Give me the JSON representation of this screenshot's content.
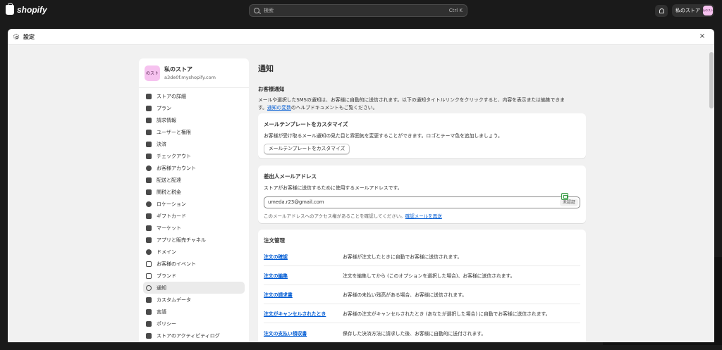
{
  "topbar": {
    "logo_text": "shopify",
    "search_placeholder": "検索",
    "search_shortcut": "Ctrl K",
    "store_name": "私のストア",
    "store_avatar_text": "私のスト"
  },
  "modal": {
    "title": "設定",
    "close_label": "×"
  },
  "sidebar": {
    "store_avatar_text": "のスト",
    "store_name": "私のストア",
    "store_domain": "a3de0f.myshopify.com",
    "items": [
      {
        "label": "ストアの詳細",
        "icon": "store-icon"
      },
      {
        "label": "プラン",
        "icon": "plan-icon"
      },
      {
        "label": "請求情報",
        "icon": "billing-icon"
      },
      {
        "label": "ユーザーと権限",
        "icon": "users-icon"
      },
      {
        "label": "決済",
        "icon": "payments-icon"
      },
      {
        "label": "チェックアウト",
        "icon": "cart-icon"
      },
      {
        "label": "お客様アカウント",
        "icon": "account-icon"
      },
      {
        "label": "配送と配達",
        "icon": "truck-icon"
      },
      {
        "label": "関税と税金",
        "icon": "tax-icon"
      },
      {
        "label": "ロケーション",
        "icon": "location-icon"
      },
      {
        "label": "ギフトカード",
        "icon": "gift-card-icon"
      },
      {
        "label": "マーケット",
        "icon": "market-icon"
      },
      {
        "label": "アプリと販売チャネル",
        "icon": "apps-icon"
      },
      {
        "label": "ドメイン",
        "icon": "globe-icon"
      },
      {
        "label": "お客様のイベント",
        "icon": "events-icon"
      },
      {
        "label": "ブランド",
        "icon": "brand-icon"
      },
      {
        "label": "通知",
        "icon": "bell-icon"
      },
      {
        "label": "カスタムデータ",
        "icon": "data-icon"
      },
      {
        "label": "言語",
        "icon": "language-icon"
      },
      {
        "label": "ポリシー",
        "icon": "policy-icon"
      },
      {
        "label": "ストアのアクティビティログ",
        "icon": "list-icon"
      }
    ],
    "active_index": 16
  },
  "main": {
    "page_title": "通知",
    "customer_section_title": "お客様通知",
    "customer_desc_1": "メールや選択したSMSの通知は、お客様に自動的に送信されます。以下の通知タイトルリンクをクリックすると、内容を表示または編集できま",
    "customer_desc_2_prefix": "す。",
    "customer_desc_link": "通知の変数",
    "customer_desc_2_suffix": "のヘルプドキュメントもご覧ください。",
    "template_card": {
      "title": "メールテンプレートをカスタマイズ",
      "text": "お客様が受け取るメール通知の見た目と雰囲気を変更することができます。ロゴとテーマ色を追加しましょう。",
      "button": "メールテンプレートをカスタマイズ"
    },
    "sender_card": {
      "title": "差出人メールアドレス",
      "text": "ストアがお客様に送信するために使用するメールアドレスです。",
      "email_value": "umeda.r23@gmail.com",
      "badge": "未認証",
      "note_prefix": "このメールアドレスへのアクセス権があることを確認してください。",
      "note_link": "確認メールを再送"
    },
    "orders_card": {
      "title": "注文管理",
      "rows": [
        {
          "link": "注文の確認",
          "desc": "お客様が注文したときに自動でお客様に送信されます。"
        },
        {
          "link": "注文の編集",
          "desc": "注文を編集してから (このオプションを選択した場合)、お客様に送信されます。"
        },
        {
          "link": "注文の請求書",
          "desc": "お客様の未払い残高がある場合、お客様に送信されます。"
        },
        {
          "link": "注文がキャンセルされたとき",
          "desc": "お客様の注文がキャンセルされたとき (あなたが選択した場合) に自動でお客様に送信されます。"
        },
        {
          "link": "注文の支払い領収書",
          "desc": "保存した決済方法に請求した後、お客様に自動的に送付されます。"
        }
      ]
    }
  },
  "colors": {
    "topbar_bg": "#1a1a1a",
    "modal_bg": "#f1f1f1",
    "link": "#005bd3",
    "avatar_bg": "#f6c2ef"
  }
}
